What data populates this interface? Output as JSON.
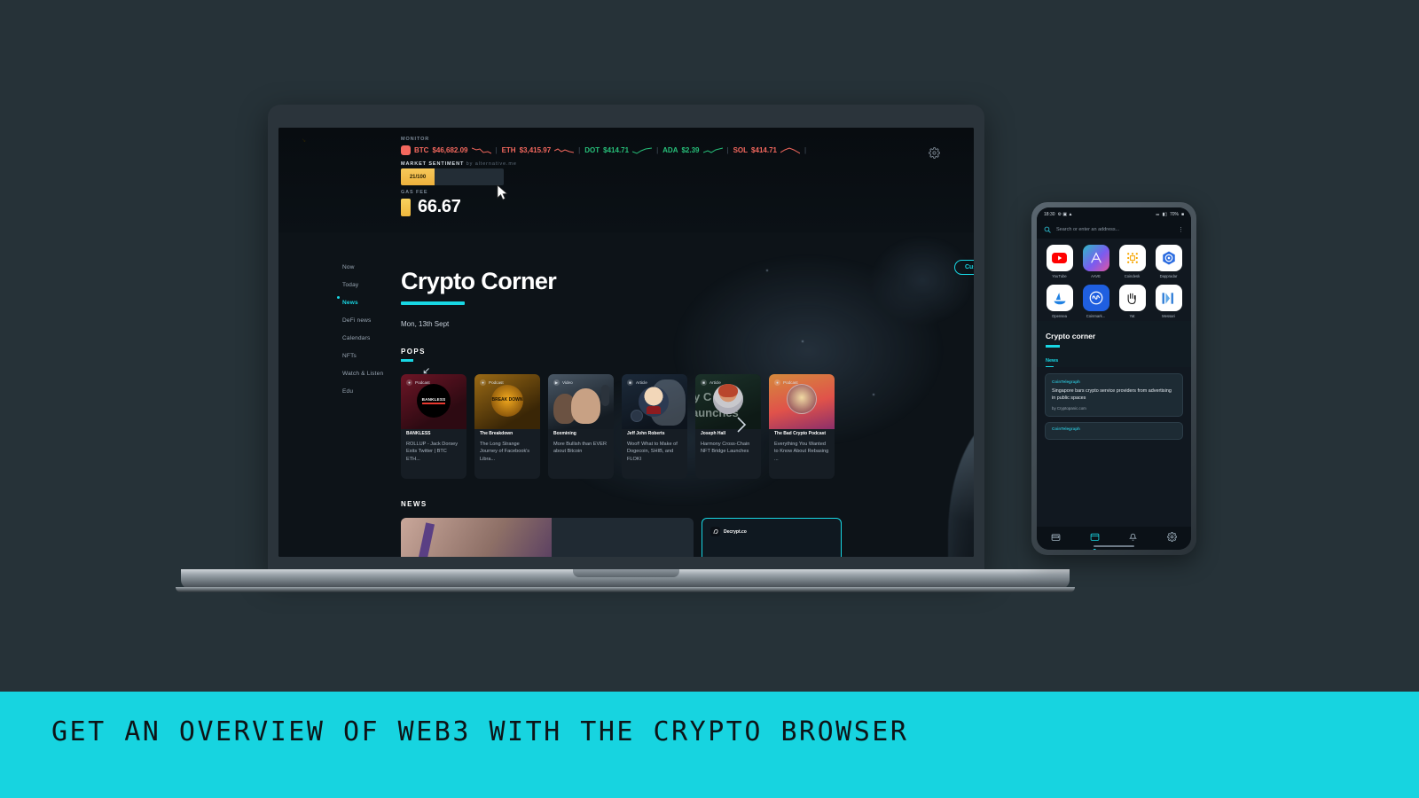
{
  "caption": {
    "text": "GET AN OVERVIEW OF WEB3 WITH THE CRYPTO BROWSER"
  },
  "colors": {
    "accent": "#18D7E4",
    "background": "#263238",
    "up": "#27c07a",
    "down": "#f4685e",
    "warn": "#f0b93f"
  },
  "laptop": {
    "monitor": {
      "label": "MONITOR",
      "tickers": [
        {
          "symbol": "BTC",
          "price": "$46,682.09",
          "direction": "down"
        },
        {
          "symbol": "ETH",
          "price": "$3,415.97",
          "direction": "down"
        },
        {
          "symbol": "DOT",
          "price": "$414.71",
          "direction": "up"
        },
        {
          "symbol": "ADA",
          "price": "$2.39",
          "direction": "up"
        },
        {
          "symbol": "SOL",
          "price": "$414.71",
          "direction": "down"
        }
      ],
      "settings_icon": "gear-icon",
      "sentiment": {
        "label": "MARKET SENTIMENT",
        "source": "by alternative.me",
        "value": "21/100",
        "trend": "down"
      },
      "gas": {
        "label": "GAS FEE",
        "value": "66.67"
      }
    },
    "sidebar": {
      "items": [
        {
          "label": "Now",
          "active": false
        },
        {
          "label": "Today",
          "active": false
        },
        {
          "label": "News",
          "active": true
        },
        {
          "label": "DeFi news",
          "active": false
        },
        {
          "label": "Calendars",
          "active": false
        },
        {
          "label": "NFTs",
          "active": false
        },
        {
          "label": "Watch & Listen",
          "active": false
        },
        {
          "label": "Edu",
          "active": false
        }
      ]
    },
    "hero": {
      "title": "Crypto Corner",
      "date": "Mon, 13th Sept",
      "customise_label": "Customise"
    },
    "pops": {
      "heading": "POPS",
      "cards": [
        {
          "type": "Podcast",
          "source": "BANKLESS",
          "title": "ROLLUP - Jack Dorsey Exits Twitter | BTC ETH...",
          "logo_text": "BANKLESS"
        },
        {
          "type": "Podcast",
          "source": "The Breakdown",
          "title": "The Long Strange Journey of Facebook's Libra...",
          "logo_text": "BREAK DOWN"
        },
        {
          "type": "Video",
          "source": "Boxmining",
          "title": "More Bullish than EVER about Bitcoin"
        },
        {
          "type": "Article",
          "source": "Jeff John Roberts",
          "title": "Woof! What to Make of Dogecoin, SHIB, and FLOKI"
        },
        {
          "type": "Article",
          "source": "Joseph Hall",
          "title": "Harmony Cross-Chain NFT Bridge Launches"
        },
        {
          "type": "Podcast",
          "source": "The Bad Crypto Podcast",
          "title": "Everything You Wanted to Know About Rebasing ..."
        }
      ],
      "next_arrow": "chevron-right-icon"
    },
    "news": {
      "heading": "NEWS",
      "cards": [
        {
          "source": ""
        },
        {
          "source": "Decrypt.co",
          "highlighted": true
        }
      ]
    }
  },
  "phone": {
    "status": {
      "time": "18:30",
      "battery": "70%"
    },
    "search": {
      "placeholder": "Search or enter an address...",
      "menu_icon": "more-vertical-icon"
    },
    "apps": [
      {
        "label": "YouTube",
        "icon": "youtube-icon"
      },
      {
        "label": "AAVE",
        "icon": "aave-icon"
      },
      {
        "label": "Coindesk",
        "icon": "coindesk-icon"
      },
      {
        "label": "Dappradar",
        "icon": "dappradar-icon"
      },
      {
        "label": "Opensea",
        "icon": "opensea-icon"
      },
      {
        "label": "Coinmark...",
        "icon": "coinmarketcap-icon"
      },
      {
        "label": "Yat",
        "icon": "yat-icon"
      },
      {
        "label": "Messari",
        "icon": "messari-icon"
      }
    ],
    "hero": {
      "title": "Crypto corner",
      "section": "News"
    },
    "news": [
      {
        "source": "CoinTelegraph",
        "headline": "Singapore bars crypto service providers from advertising in public spaces",
        "by": "by Cryptopanic.com"
      },
      {
        "source": "CoinTelegraph",
        "headline": "",
        "by": ""
      }
    ],
    "nav": [
      {
        "name": "wallet",
        "active": false
      },
      {
        "name": "browser",
        "active": true
      },
      {
        "name": "notifications",
        "active": false
      },
      {
        "name": "settings",
        "active": false
      }
    ]
  }
}
